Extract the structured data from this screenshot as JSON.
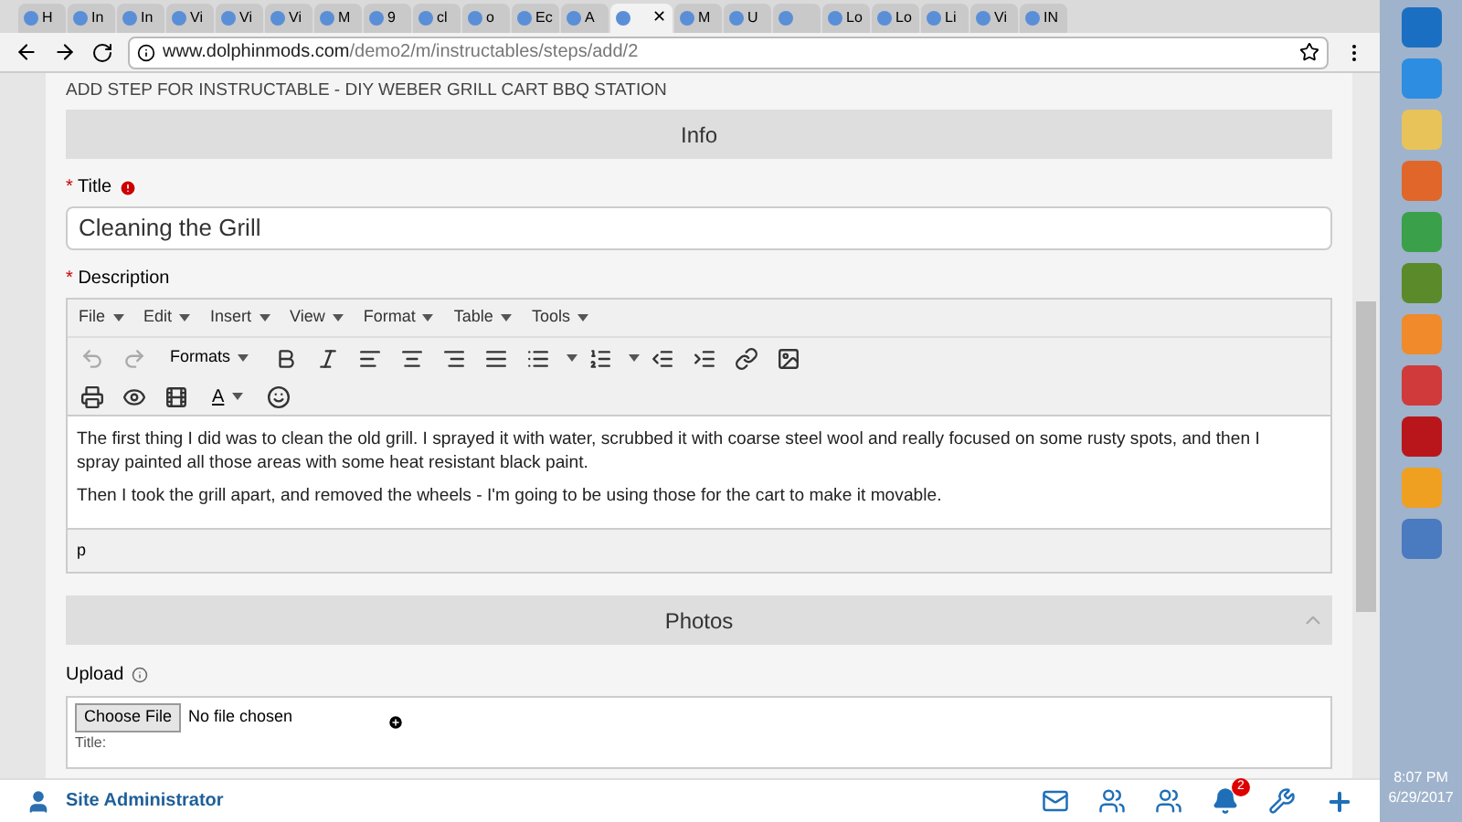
{
  "browser": {
    "tabs": [
      {
        "label": "H",
        "selected": false
      },
      {
        "label": "In",
        "selected": false
      },
      {
        "label": "In",
        "selected": false
      },
      {
        "label": "Vi",
        "selected": false
      },
      {
        "label": "Vi",
        "selected": false
      },
      {
        "label": "Vi",
        "selected": false
      },
      {
        "label": "M",
        "selected": false
      },
      {
        "label": "9",
        "selected": false
      },
      {
        "label": "cl",
        "selected": false
      },
      {
        "label": "o",
        "selected": false
      },
      {
        "label": "Ec",
        "selected": false
      },
      {
        "label": "A",
        "selected": false
      },
      {
        "selected": true,
        "close": "✕"
      },
      {
        "label": "M",
        "selected": false
      },
      {
        "label": "U",
        "selected": false
      },
      {
        "selected": false
      },
      {
        "label": "Lo",
        "selected": false
      },
      {
        "label": "Lo",
        "selected": false
      },
      {
        "label": "Li",
        "selected": false
      },
      {
        "label": "Vi",
        "selected": false
      },
      {
        "label": "IN",
        "selected": false
      }
    ],
    "url_host": "www.dolphinmods.com",
    "url_path": "/demo2/m/instructables/steps/add/2"
  },
  "page": {
    "heading": "ADD STEP FOR INSTRUCTABLE - DIY WEBER GRILL CART BBQ STATION",
    "info_section": {
      "title": "Info"
    },
    "title_field": {
      "label": "Title",
      "required_mark": "*",
      "value": "Cleaning the Grill"
    },
    "description": {
      "label": "Description",
      "required_mark": "*",
      "menus": [
        "File",
        "Edit",
        "Insert",
        "View",
        "Format",
        "Table",
        "Tools"
      ],
      "formats_label": "Formats",
      "text_color_label": "A",
      "paragraphs": [
        "The first thing I did was to clean the old grill. I sprayed it with water, scrubbed it with coarse steel wool and really focused on some rusty spots, and then I spray painted all those areas with some heat resistant black paint.",
        "Then I took the grill apart, and removed the wheels - I'm going to be using those for the cart to make it movable."
      ],
      "path": "p"
    },
    "photos_section": {
      "title": "Photos",
      "expanded": true
    },
    "upload": {
      "label": "Upload",
      "button": "Choose File",
      "status": "No file chosen",
      "title_label": "Title:"
    }
  },
  "bottom_bar": {
    "user": "Site Administrator",
    "notifications": "2"
  },
  "taskbar": {
    "time": "8:07 PM",
    "date": "6/29/2017"
  }
}
